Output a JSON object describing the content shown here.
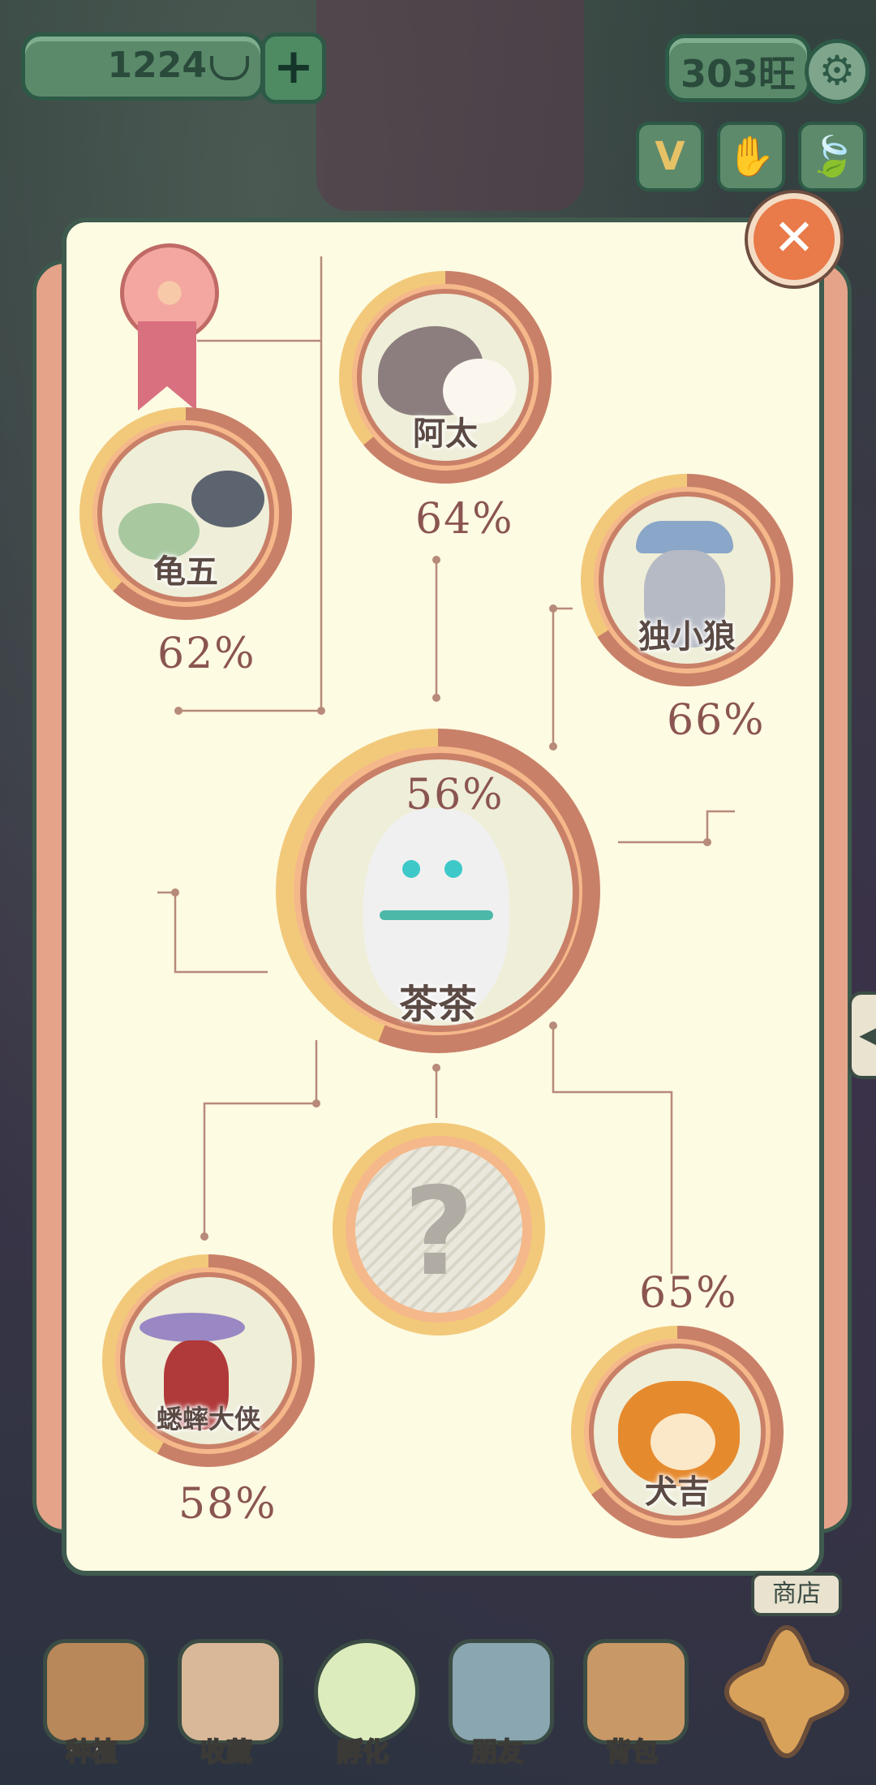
{
  "header": {
    "coins": "1224",
    "coin_icon": "ingot-icon",
    "plus_label": "+",
    "wang": "303旺",
    "settings_icon": "gear-icon",
    "quick_buttons": [
      "V",
      "✋",
      "🍃"
    ]
  },
  "panel": {
    "close_label": "✕",
    "badge_icon": "flower-ribbon-icon",
    "center": {
      "name": "茶茶",
      "percent": "56%"
    },
    "characters": [
      {
        "id": "atai",
        "name": "阿太",
        "percent": "64%"
      },
      {
        "id": "guiwu",
        "name": "龟五",
        "percent": "62%"
      },
      {
        "id": "duxiaolang",
        "name": "独小狼",
        "percent": "66%"
      },
      {
        "id": "quxidaxia",
        "name": "蟋蟀大侠",
        "percent": "58%"
      },
      {
        "id": "quanji",
        "name": "犬吉",
        "percent": "65%"
      }
    ],
    "unknown_label": "?"
  },
  "sidebar": {
    "shop_label": "商店",
    "tab_arrow": "◀"
  },
  "nav": {
    "items": [
      {
        "label": "种植",
        "icon": "plant-icon"
      },
      {
        "label": "收藏",
        "icon": "book-icon"
      },
      {
        "label": "孵化",
        "icon": "egg-icon"
      },
      {
        "label": "朋友",
        "icon": "cat-icon"
      },
      {
        "label": "背包",
        "icon": "basket-icon"
      }
    ]
  },
  "colors": {
    "panel_bg": "#fdfbe2",
    "ring_outer": "#c98068",
    "ring_fill": "#f2c97a",
    "accent": "#e97a4a"
  }
}
